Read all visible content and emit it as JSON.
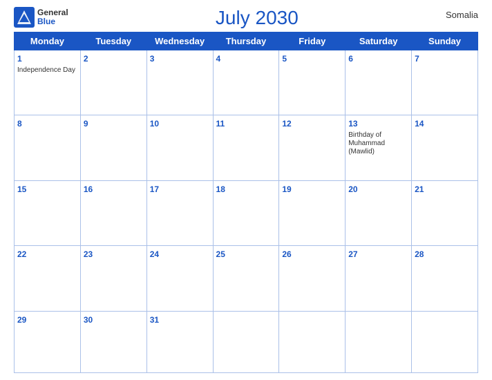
{
  "header": {
    "title": "July 2030",
    "country": "Somalia",
    "logo": {
      "general": "General",
      "blue": "Blue"
    }
  },
  "days_of_week": [
    "Monday",
    "Tuesday",
    "Wednesday",
    "Thursday",
    "Friday",
    "Saturday",
    "Sunday"
  ],
  "weeks": [
    [
      {
        "day": 1,
        "holiday": "Independence Day"
      },
      {
        "day": 2,
        "holiday": ""
      },
      {
        "day": 3,
        "holiday": ""
      },
      {
        "day": 4,
        "holiday": ""
      },
      {
        "day": 5,
        "holiday": ""
      },
      {
        "day": 6,
        "holiday": ""
      },
      {
        "day": 7,
        "holiday": ""
      }
    ],
    [
      {
        "day": 8,
        "holiday": ""
      },
      {
        "day": 9,
        "holiday": ""
      },
      {
        "day": 10,
        "holiday": ""
      },
      {
        "day": 11,
        "holiday": ""
      },
      {
        "day": 12,
        "holiday": ""
      },
      {
        "day": 13,
        "holiday": "Birthday of Muhammad (Mawlid)"
      },
      {
        "day": 14,
        "holiday": ""
      }
    ],
    [
      {
        "day": 15,
        "holiday": ""
      },
      {
        "day": 16,
        "holiday": ""
      },
      {
        "day": 17,
        "holiday": ""
      },
      {
        "day": 18,
        "holiday": ""
      },
      {
        "day": 19,
        "holiday": ""
      },
      {
        "day": 20,
        "holiday": ""
      },
      {
        "day": 21,
        "holiday": ""
      }
    ],
    [
      {
        "day": 22,
        "holiday": ""
      },
      {
        "day": 23,
        "holiday": ""
      },
      {
        "day": 24,
        "holiday": ""
      },
      {
        "day": 25,
        "holiday": ""
      },
      {
        "day": 26,
        "holiday": ""
      },
      {
        "day": 27,
        "holiday": ""
      },
      {
        "day": 28,
        "holiday": ""
      }
    ],
    [
      {
        "day": 29,
        "holiday": ""
      },
      {
        "day": 30,
        "holiday": ""
      },
      {
        "day": 31,
        "holiday": ""
      },
      {
        "day": null,
        "holiday": ""
      },
      {
        "day": null,
        "holiday": ""
      },
      {
        "day": null,
        "holiday": ""
      },
      {
        "day": null,
        "holiday": ""
      }
    ]
  ]
}
